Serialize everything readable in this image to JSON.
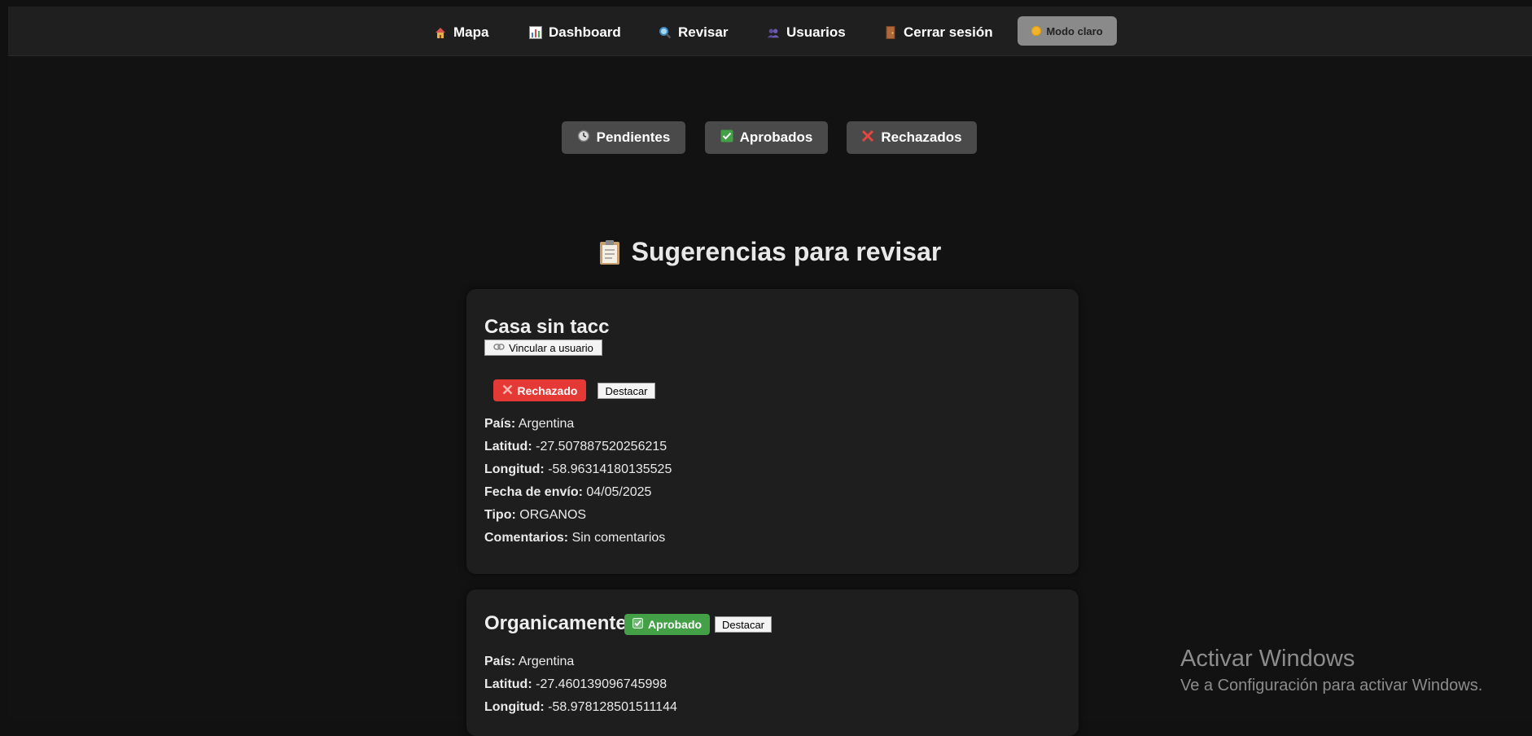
{
  "nav": {
    "items": [
      {
        "label": "Mapa",
        "icon": "house-icon"
      },
      {
        "label": "Dashboard",
        "icon": "bar-chart-icon"
      },
      {
        "label": "Revisar",
        "icon": "magnifier-icon"
      },
      {
        "label": "Usuarios",
        "icon": "users-icon"
      },
      {
        "label": "Cerrar sesión",
        "icon": "door-icon"
      }
    ],
    "mode_label": "Modo claro"
  },
  "filters": {
    "pending": "Pendientes",
    "approved": "Aprobados",
    "rejected": "Rechazados"
  },
  "page": {
    "title": "Sugerencias para revisar"
  },
  "labels": {
    "country": "País:",
    "latitude": "Latitud:",
    "longitude": "Longitud:",
    "date": "Fecha de envío:",
    "type": "Tipo:",
    "comments": "Comentarios:",
    "link_user": "Vincular a usuario",
    "highlight": "Destacar"
  },
  "cards": [
    {
      "name": "Casa sin tacc",
      "status": "Rechazado",
      "country": "Argentina",
      "latitude": "-27.507887520256215",
      "longitude": "-58.96314180135525",
      "date": "04/05/2025",
      "type": "ORGANOS",
      "comments": "Sin comentarios"
    },
    {
      "name": "Organicamente",
      "status": "Aprobado",
      "country": "Argentina",
      "latitude": "-27.460139096745998",
      "longitude": "-58.978128501511144"
    }
  ],
  "watermark": {
    "title": "Activar Windows",
    "subtitle": "Ve a Configuración para activar Windows."
  },
  "colors": {
    "background": "#111111",
    "navbar": "#1f1f1f",
    "card": "#1e1e1e",
    "rejected": "#e53935",
    "approved": "#43a047",
    "filter_button": "#4a4a4a"
  }
}
